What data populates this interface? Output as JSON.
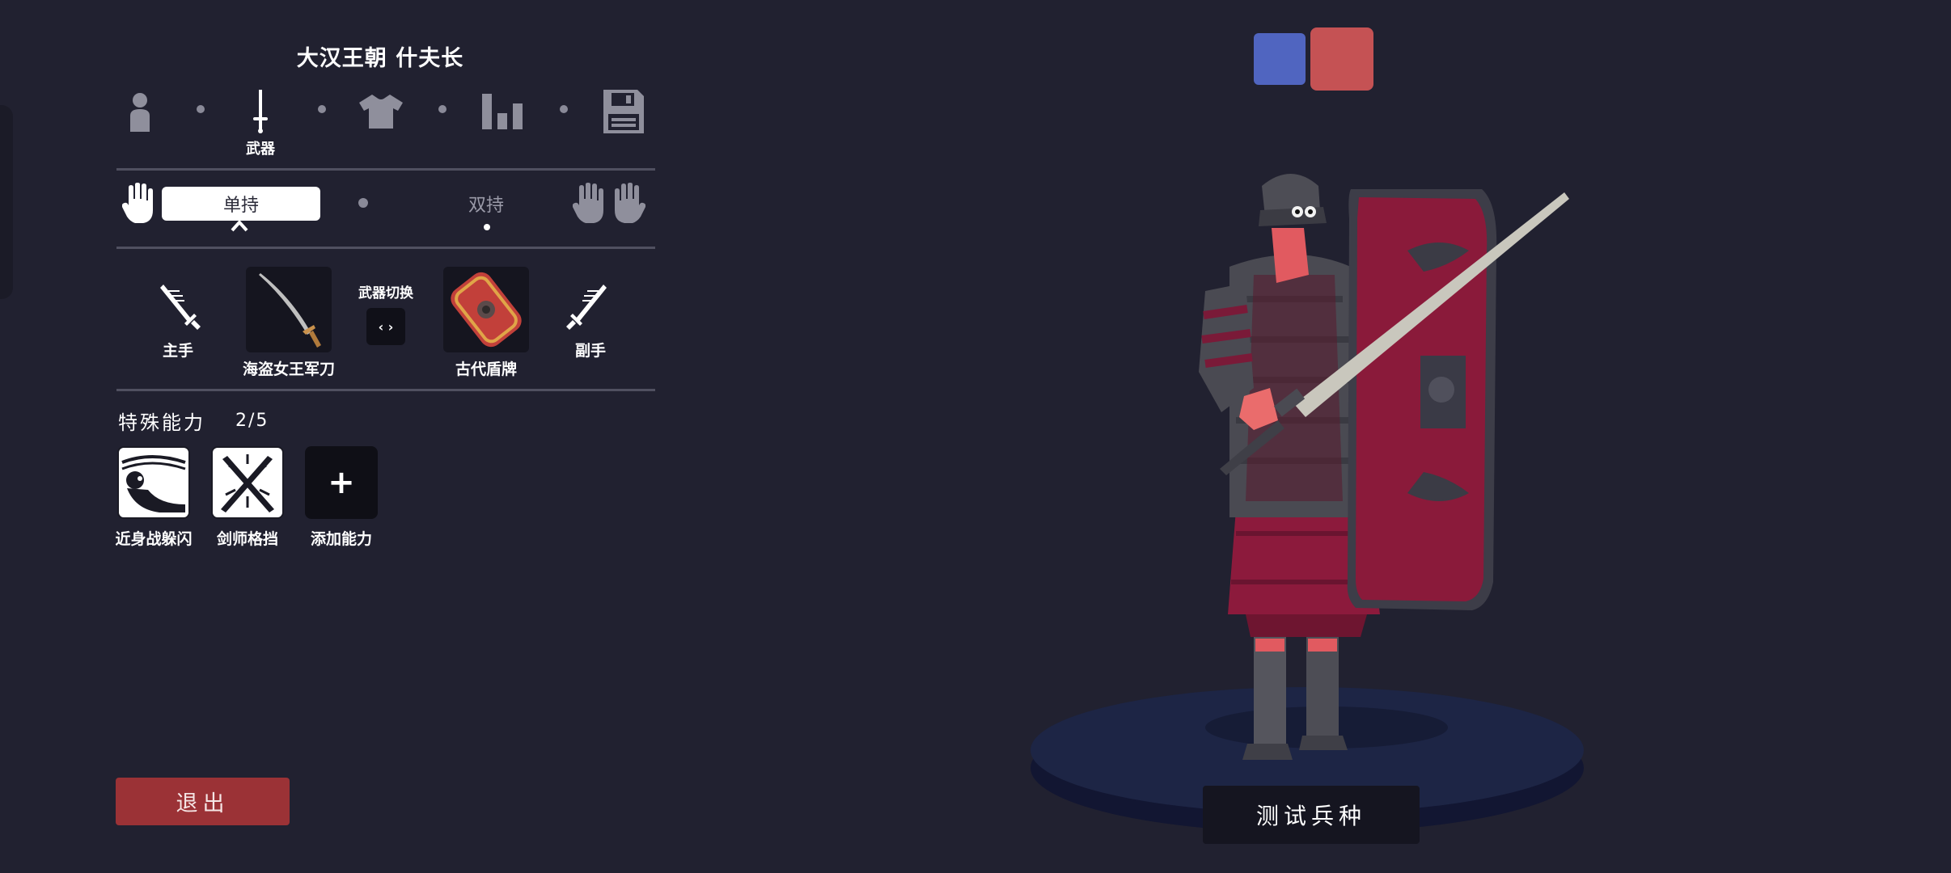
{
  "unit": {
    "title": "大汉王朝 什夫长"
  },
  "steps": [
    {
      "name": "unit",
      "icon": "person-icon"
    },
    {
      "name": "weapons",
      "icon": "sword-icon",
      "label": "武器"
    },
    {
      "name": "clothing",
      "icon": "shirt-icon"
    },
    {
      "name": "stats",
      "icon": "bar-chart-icon"
    },
    {
      "name": "save",
      "icon": "floppy-disk-icon"
    }
  ],
  "grip": {
    "single_label": "单持",
    "dual_label": "双持",
    "single_icon": "one-hand-icon",
    "dual_icon": "two-hands-icon"
  },
  "weapons": {
    "main_hand_label": "主手",
    "main_weapon": "海盗女王军刀",
    "switch_label": "武器切换",
    "switch_symbol": "‹ ›",
    "off_weapon": "古代盾牌",
    "off_hand_label": "副手"
  },
  "abilities": {
    "title": "特殊能力",
    "count": "2/5",
    "items": [
      {
        "label": "近身战躲闪",
        "icon": "dodge-icon"
      },
      {
        "label": "剑师格挡",
        "icon": "crossed-swords-icon"
      },
      {
        "label": "添加能力",
        "icon": "plus-icon",
        "symbol": "+"
      }
    ]
  },
  "buttons": {
    "exit": "退出",
    "test": "测试兵种"
  },
  "teams": [
    {
      "name": "blue",
      "color": "#5065c0"
    },
    {
      "name": "red",
      "color": "#c55254"
    }
  ]
}
